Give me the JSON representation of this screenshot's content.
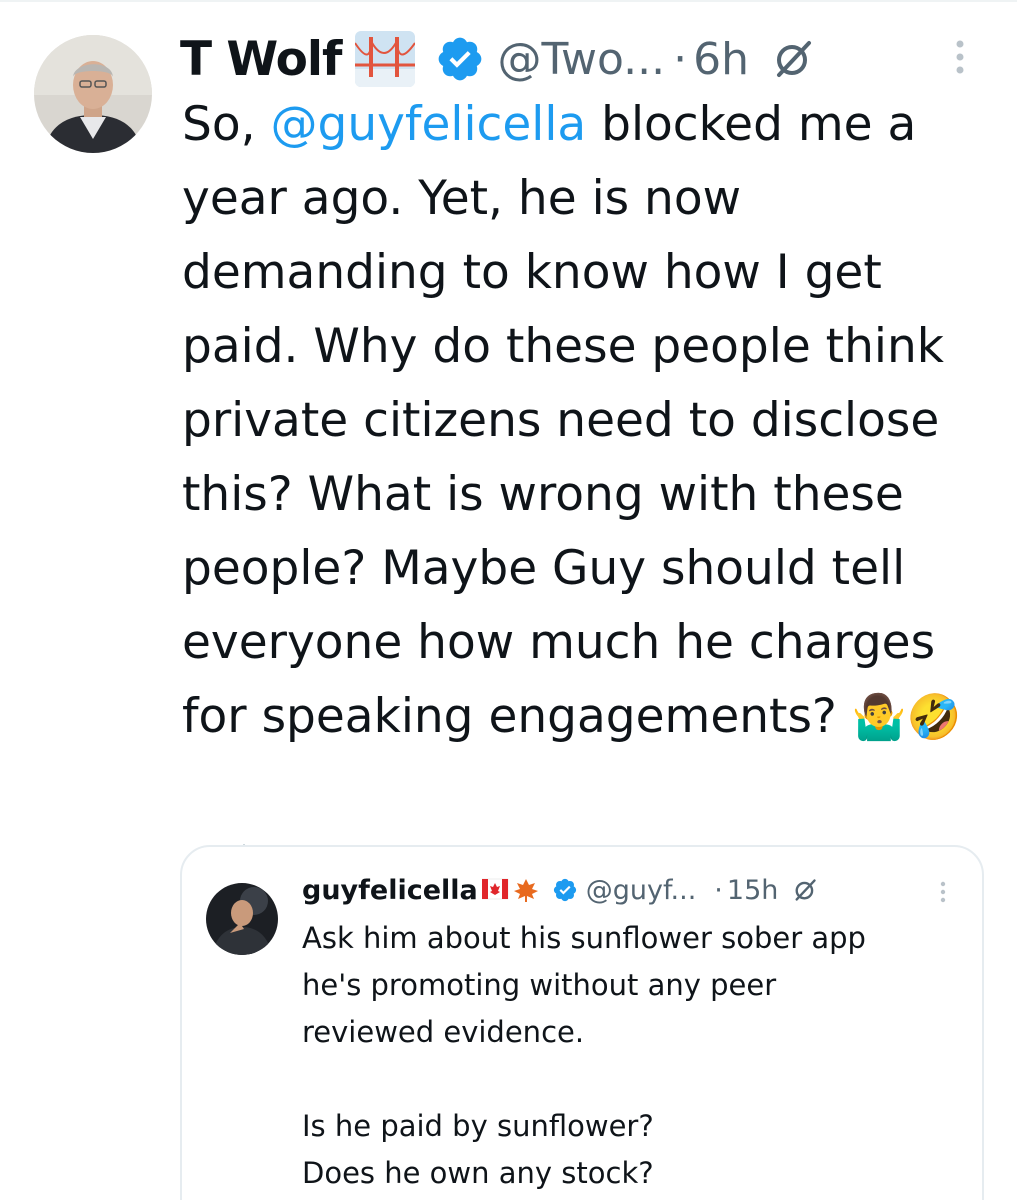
{
  "tweet": {
    "display_name": "T Wolf",
    "handle": "@Two...",
    "dot": "·",
    "time": "6h",
    "text_before_mention": "So, ",
    "mention": "@guyfelicella",
    "text_after_mention": " blocked me a year ago. Yet, he is now demanding to know how I get paid. Why do these people think private citizens need to disclose this? What is wrong with these people? Maybe Guy should tell everyone how much he charges for speaking engagements? ",
    "emojis": "🤷‍♂️🤣",
    "badge_icon": "golden-gate-bridge-icon",
    "verified_color": "#1d9bf0"
  },
  "quoted_tweet": {
    "display_name": "guyfelicella",
    "flags": "🇨🇦🍁",
    "handle": "@guyf...",
    "dot": "·",
    "time": "15h",
    "text": "Ask him about his sunflower sober app\nhe's promoting without any peer\nreviewed evidence.\n\nIs he paid by sunflower?\nDoes he own any stock?"
  },
  "colors": {
    "text": "#0f1419",
    "secondary": "#536471",
    "link": "#1d9bf0",
    "border": "#e6ecf0"
  }
}
